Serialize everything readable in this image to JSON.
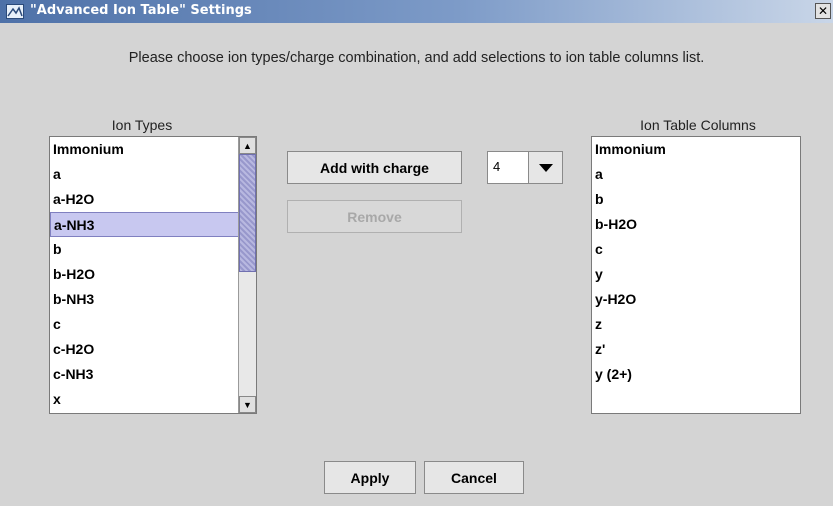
{
  "window": {
    "title": "\"Advanced Ion Table\" Settings",
    "close_glyph": "✕"
  },
  "instructions": "Please choose ion types/charge combination, and add selections to ion table columns list.",
  "ion_types": {
    "label": "Ion Types",
    "items": [
      "Immonium",
      "a",
      "a-H2O",
      "a-NH3",
      "b",
      "b-H2O",
      "b-NH3",
      "c",
      "c-H2O",
      "c-NH3",
      "x"
    ],
    "selected": "a-NH3"
  },
  "buttons": {
    "add_with_charge": "Add with charge",
    "remove": "Remove",
    "apply": "Apply",
    "cancel": "Cancel"
  },
  "charge_select": {
    "value": "4"
  },
  "ion_table_columns": {
    "label": "Ion Table Columns",
    "items": [
      "Immonium",
      "a",
      "b",
      "b-H2O",
      "c",
      "y",
      "y-H2O",
      "z",
      "z'",
      "y (2+)"
    ]
  }
}
